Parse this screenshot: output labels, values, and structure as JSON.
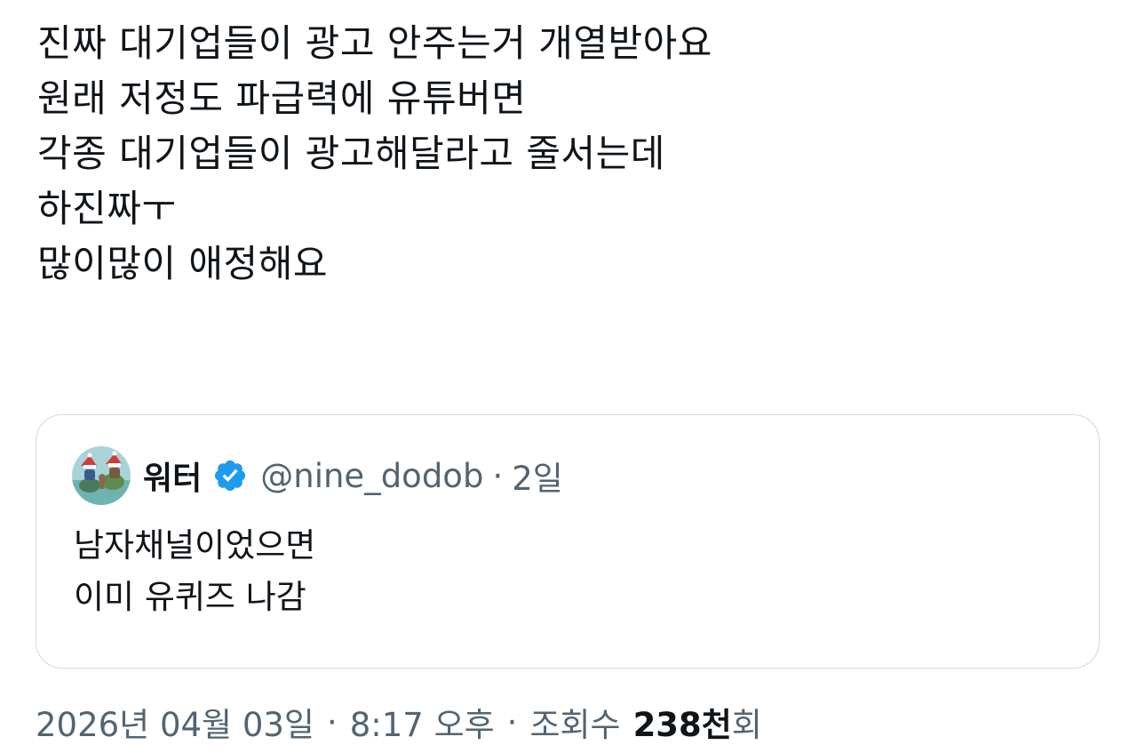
{
  "tweet": {
    "lines": [
      "진짜 대기업들이 광고 안주는거 개열받아요",
      "원래 저정도 파급력에 유튜버면",
      "각종 대기업들이 광고해달라고 줄서는데",
      "하진짜ㅜ",
      "많이많이 애정해요"
    ]
  },
  "quote": {
    "author_name": "워터",
    "handle": "@nine_dodob",
    "separator": "·",
    "time_ago": "2일",
    "avatar_icon": "avatar-image",
    "verified_icon": "verified-badge-icon",
    "verified_color": "#1d9bf0",
    "lines": [
      "남자채널이었으면",
      "이미 유퀴즈 나감"
    ]
  },
  "meta": {
    "date": "2026년 04월 03일",
    "separator": "·",
    "time": "8:17 오후",
    "views_label": "조회수",
    "views_count": "238천",
    "views_suffix": "회"
  }
}
